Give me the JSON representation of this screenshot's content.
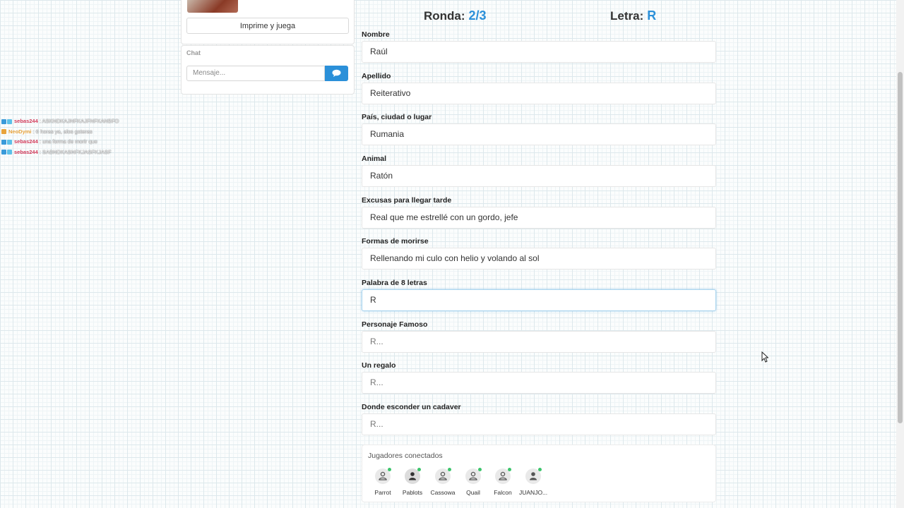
{
  "left": {
    "print_button": "Imprime y juega",
    "chat_title": "Chat",
    "chat_placeholder": "Mensaje..."
  },
  "overlay_chat": [
    {
      "user": "sebas244",
      "message": ": ASKNDKAJNFKAJFNFKANBFO",
      "user_color": "#d23b5a"
    },
    {
      "user": "NeoDymi",
      "message": ": 6 horas ya, alos goteras",
      "user_color": "#e8a33c"
    },
    {
      "user": "sebas244",
      "message": ": una forma de morir que",
      "user_color": "#d23b5a"
    },
    {
      "user": "sebas244",
      "message": ": SABNDKASNFKJASFKJASF",
      "user_color": "#d23b5a"
    }
  ],
  "header": {
    "round_label": "Ronda:",
    "round_value": "2/3",
    "letter_label": "Letra:",
    "letter_value": "R"
  },
  "fields": [
    {
      "label": "Nombre",
      "value": "Raúl"
    },
    {
      "label": "Apellido",
      "value": "Reiterativo"
    },
    {
      "label": "País, ciudad o lugar",
      "value": "Rumania"
    },
    {
      "label": "Animal",
      "value": "Ratón"
    },
    {
      "label": "Excusas para llegar tarde",
      "value": "Real que me estrellé con un gordo, jefe"
    },
    {
      "label": "Formas de morirse",
      "value": "Rellenando mi culo con helio y volando al sol"
    },
    {
      "label": "Palabra de 8 letras",
      "value": "R"
    },
    {
      "label": "Personaje Famoso",
      "placeholder": "R..."
    },
    {
      "label": "Un regalo",
      "placeholder": "R..."
    },
    {
      "label": "Donde esconder un cadaver",
      "placeholder": "R..."
    }
  ],
  "players": {
    "title": "Jugadores conectados",
    "list": [
      "Parrot",
      "Pablots",
      "Cassowa",
      "Quail",
      "Falcon",
      "JUANJO..."
    ]
  },
  "colors": {
    "accent": "#2b90d9",
    "online": "#3cc46b"
  }
}
